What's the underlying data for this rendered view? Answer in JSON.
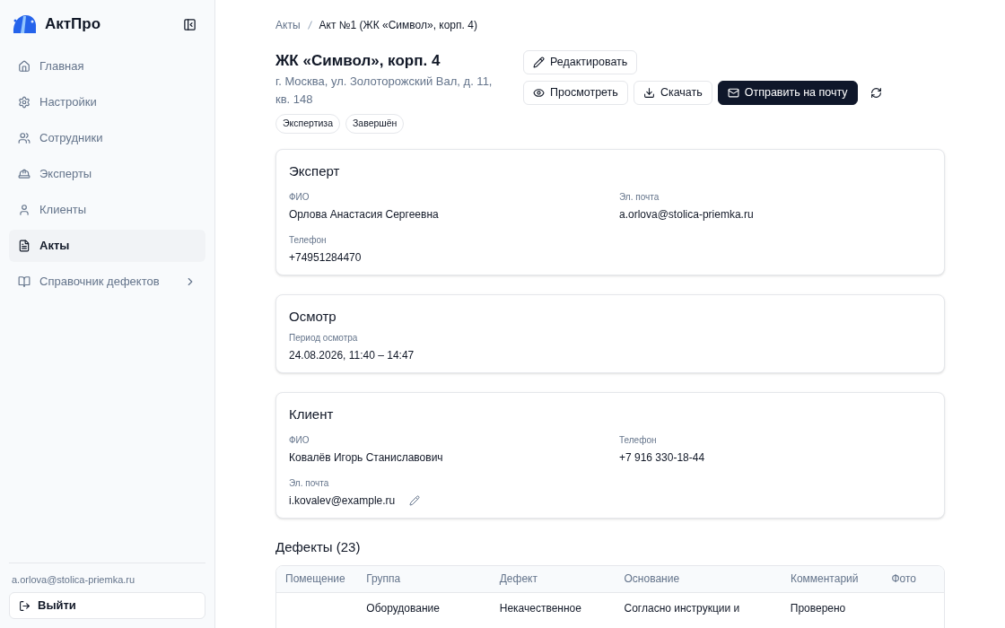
{
  "sidebar": {
    "brand": "АктПро",
    "items": [
      {
        "label": "Главная",
        "selected": false
      },
      {
        "label": "Настройки",
        "selected": false
      },
      {
        "label": "Сотрудники",
        "selected": false
      },
      {
        "label": "Эксперты",
        "selected": false
      },
      {
        "label": "Клиенты",
        "selected": false
      },
      {
        "label": "Акты",
        "selected": true
      },
      {
        "label": "Справочник дефектов",
        "selected": false,
        "submenu": true
      }
    ],
    "user_email": "a.orlova@stolica-priemka.ru",
    "logout": "Выйти"
  },
  "breadcrumb": [
    "Акты",
    "Акт №1 (ЖК «Символ», корп. 4)"
  ],
  "header": {
    "title": "ЖК «Символ», корп. 4",
    "address": "г. Москва, ул. Золоторожский Вал, д. 11, кв. 148",
    "tags": [
      "Экспертиза",
      "Завершён"
    ]
  },
  "actions": {
    "edit": "Редактировать",
    "view": "Просмотреть",
    "download": "Скачать",
    "send": "Отправить на почту"
  },
  "cards": [
    {
      "title": "Эксперт",
      "fields": [
        {
          "label": "ФИО",
          "value": "Орлова Анастасия Сергеевна"
        },
        {
          "label": "Эл. почта",
          "value": "a.orlova@stolica-priemka.ru"
        },
        {
          "label": "Телефон",
          "value": "+74951284470"
        }
      ]
    },
    {
      "title": "Осмотр",
      "fields": [
        {
          "label": "Период осмотра",
          "value": "24.08.2026, 11:40 – 14:47"
        }
      ]
    },
    {
      "title": "Клиент",
      "fields": [
        {
          "label": "ФИО",
          "value": "Ковалёв Игорь Станиславович"
        },
        {
          "label": "Телефон",
          "value": "+7 916 330-18-44"
        },
        {
          "label": "Эл. почта",
          "value": "i.kovalev@example.ru",
          "editable": true
        }
      ]
    }
  ],
  "defects": {
    "title": "Дефекты (23)",
    "columns": [
      "Помещение",
      "Группа",
      "Дефект",
      "Основание",
      "Комментарий",
      "Фото"
    ],
    "rows": [
      {
        "cells": [
          "",
          "Оборудование",
          "Некачественное",
          "Согласно инструкции и",
          "Проверено",
          ""
        ]
      }
    ]
  }
}
